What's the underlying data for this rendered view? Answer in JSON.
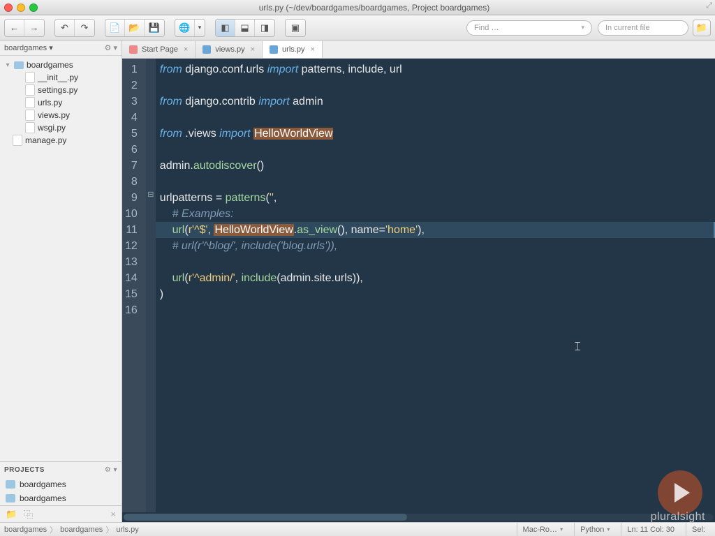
{
  "window": {
    "title": "urls.py (~/dev/boardgames/boardgames, Project boardgames)"
  },
  "toolbar": {
    "find_placeholder": "Find …",
    "scope_placeholder": "In current file"
  },
  "sidebar": {
    "header": "boardgames ▾",
    "tree": {
      "root": "boardgames",
      "items": [
        {
          "name": "__init__.py"
        },
        {
          "name": "settings.py"
        },
        {
          "name": "urls.py"
        },
        {
          "name": "views.py"
        },
        {
          "name": "wsgi.py"
        }
      ],
      "root_file": "manage.py"
    },
    "projects_label": "PROJECTS",
    "projects": [
      "boardgames",
      "boardgames"
    ]
  },
  "tabs": [
    {
      "label": "Start Page"
    },
    {
      "label": "views.py"
    },
    {
      "label": "urls.py",
      "active": true
    }
  ],
  "code": {
    "line_count": 16,
    "current_line": 11,
    "fold_marker_at": 9,
    "highlighted_symbol": "HelloWorldView"
  },
  "status": {
    "crumbs": [
      "boardgames",
      "boardgames",
      "urls.py"
    ],
    "encoding": "Mac-Ro…",
    "language": "Python",
    "position": "Ln: 11 Col: 30",
    "selection": "Sel: "
  },
  "watermark": "pluralsight"
}
